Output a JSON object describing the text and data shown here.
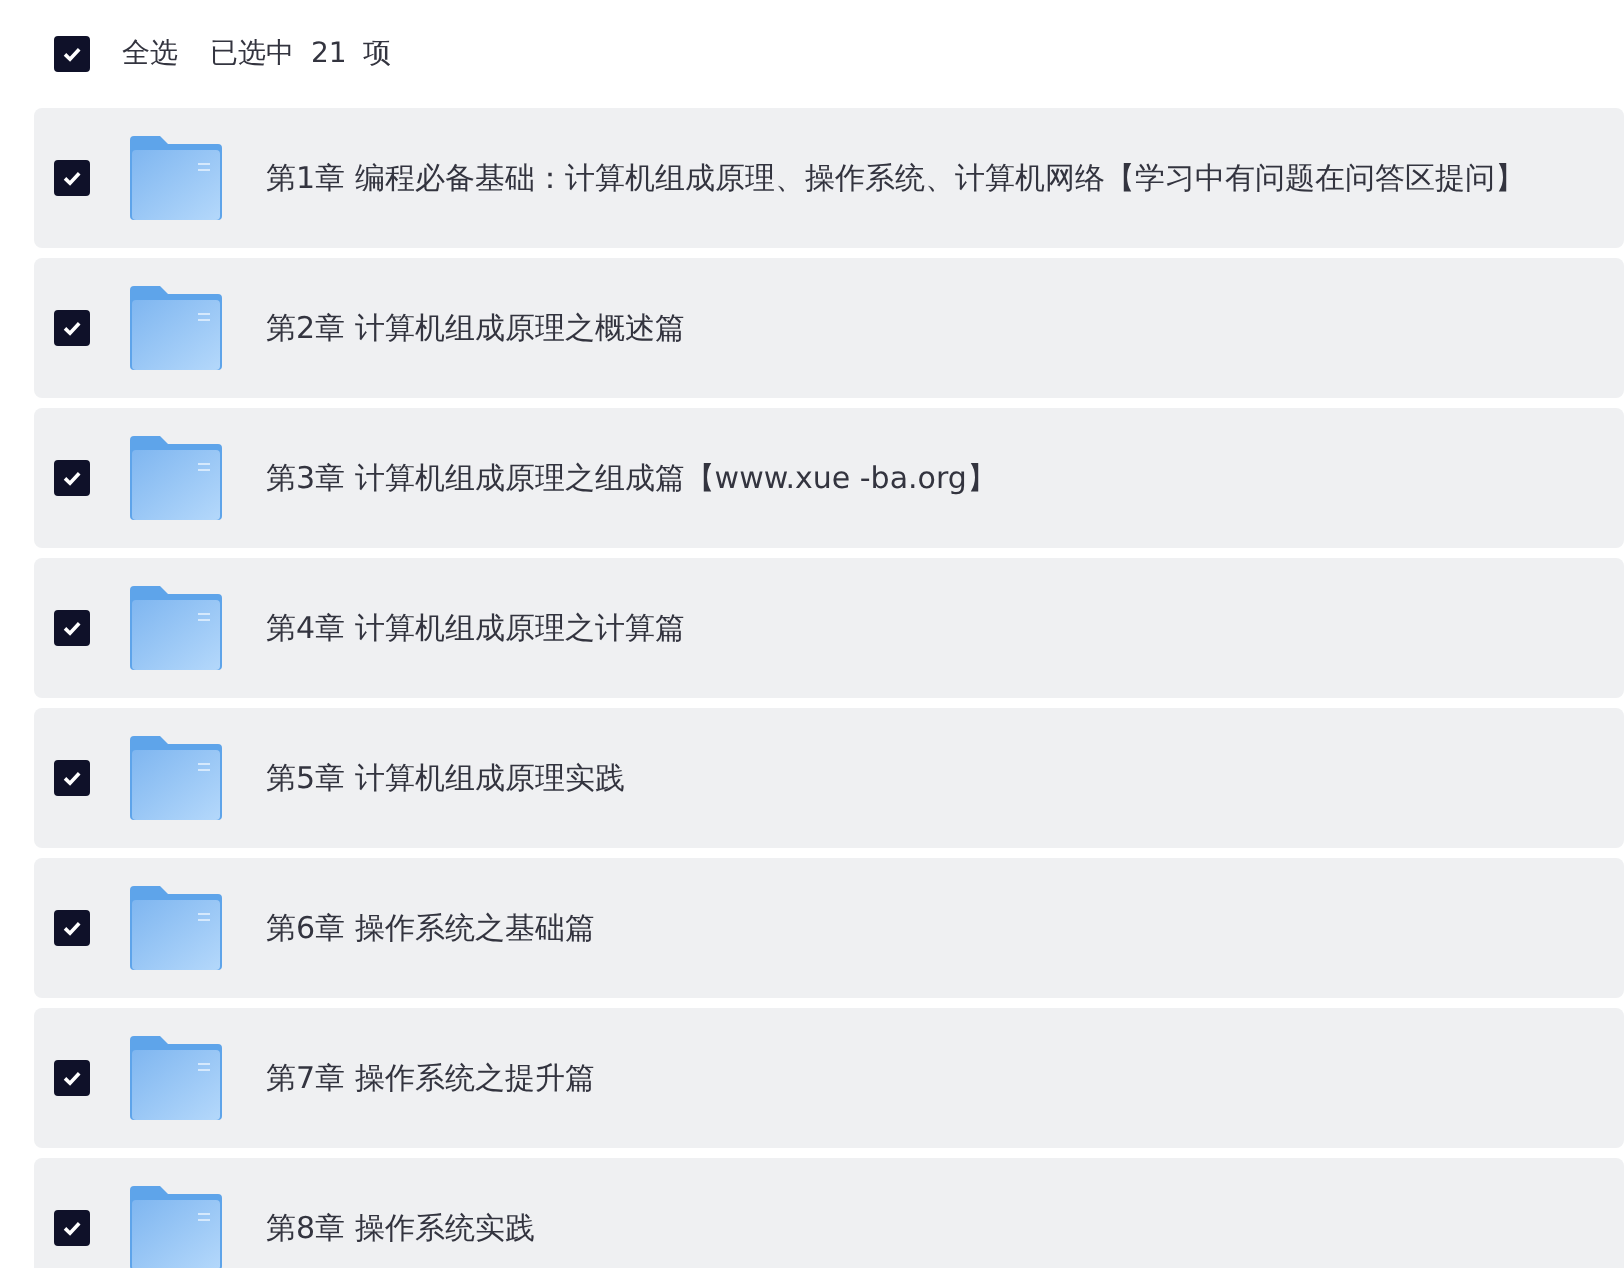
{
  "header": {
    "select_all": {
      "label": "全选",
      "checked": true
    },
    "summary": "已选中 21 项"
  },
  "items": [
    {
      "title": "第1章 编程必备基础：计算机组成原理、操作系统、计算机网络【学习中有问题在问答区提问】",
      "checked": true
    },
    {
      "title": "第2章 计算机组成原理之概述篇",
      "checked": true
    },
    {
      "title": "第3章 计算机组成原理之组成篇【www.xue -ba.org】",
      "checked": true
    },
    {
      "title": "第4章 计算机组成原理之计算篇",
      "checked": true
    },
    {
      "title": "第5章 计算机组成原理实践",
      "checked": true
    },
    {
      "title": "第6章 操作系统之基础篇",
      "checked": true
    },
    {
      "title": "第7章 操作系统之提升篇",
      "checked": true
    },
    {
      "title": "第8章 操作系统实践",
      "checked": true
    }
  ]
}
